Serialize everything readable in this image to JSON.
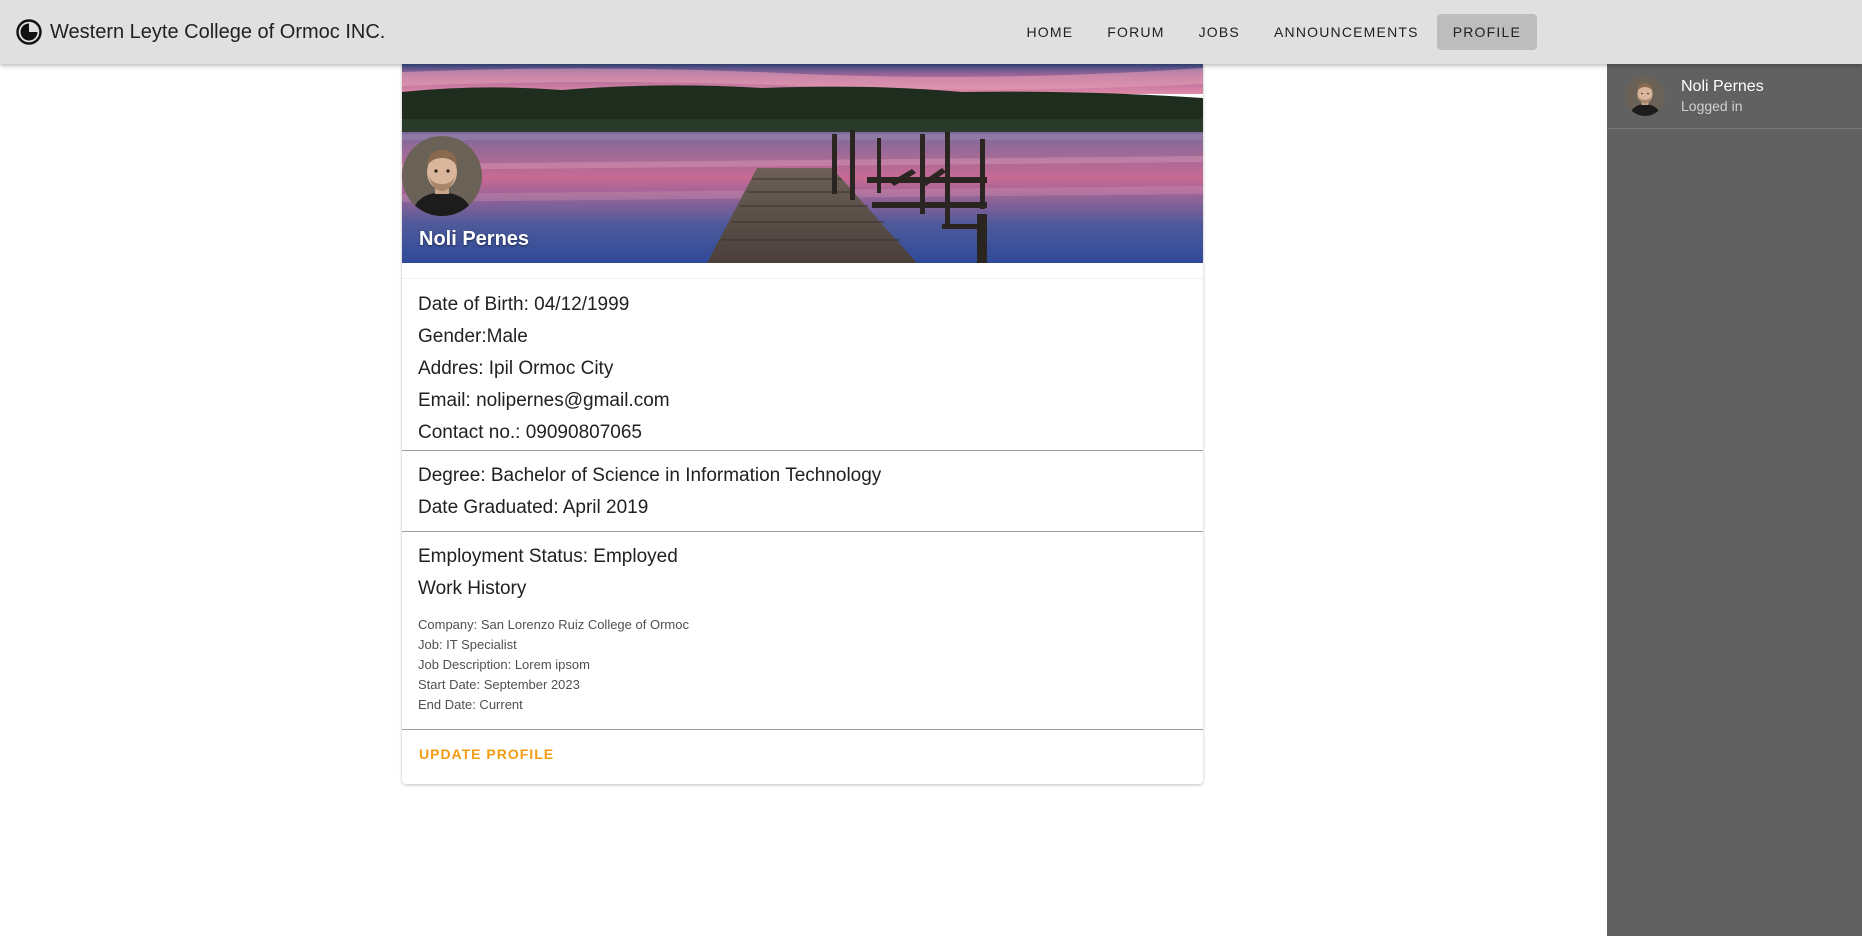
{
  "app": {
    "title": "Western Leyte College of Ormoc INC."
  },
  "nav": {
    "items": [
      {
        "label": "HOME",
        "active": false
      },
      {
        "label": "FORUM",
        "active": false
      },
      {
        "label": "JOBS",
        "active": false
      },
      {
        "label": "ANNOUNCEMENTS",
        "active": false
      },
      {
        "label": "PROFILE",
        "active": true
      }
    ]
  },
  "drawer": {
    "user_name": "Noli Pernes",
    "user_status": "Logged in"
  },
  "profile": {
    "name": "Noli Pernes",
    "dob": "Date of Birth: 04/12/1999",
    "gender": "Gender:Male",
    "address": "Addres: Ipil Ormoc City",
    "email": "Email: nolipernes@gmail.com",
    "contact": "Contact no.: 09090807065",
    "degree": "Degree: Bachelor of Science in Information Technology",
    "date_graduated": "Date Graduated: April 2019",
    "employment_status": "Employment Status: Employed",
    "work_history_title": "Work History",
    "work": {
      "company": "Company: San Lorenzo Ruiz College of Ormoc",
      "job": "Job: IT Specialist",
      "description": "Job Description: Lorem ipsom",
      "start": "Start Date: September 2023",
      "end": "End Date: Current"
    },
    "update_label": "UPDATE PROFILE"
  },
  "colors": {
    "topbar": "#e0e0e0",
    "drawer": "#616161",
    "accent": "#f39c12",
    "active_nav": "#bdbdbd"
  },
  "icons": {
    "brand": "half-circle-logo-icon"
  }
}
